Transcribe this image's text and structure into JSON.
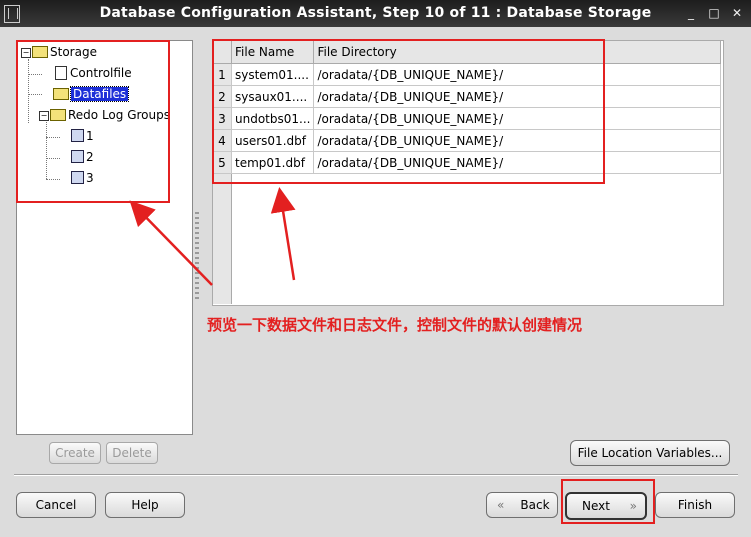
{
  "window": {
    "title": "Database Configuration Assistant, Step 10 of 11 : Database Storage",
    "minimize_glyph": "_",
    "maximize_glyph": "□",
    "close_glyph": "✕"
  },
  "tree": {
    "root": "Storage",
    "controlfile": "Controlfile",
    "datafiles": "Datafiles",
    "redo_groups": "Redo Log Groups",
    "groups": [
      "1",
      "2",
      "3"
    ]
  },
  "table": {
    "headers": [
      "File Name",
      "File Directory"
    ],
    "rows": [
      {
        "num": "1",
        "name": "system01....",
        "dir": "/oradata/{DB_UNIQUE_NAME}/"
      },
      {
        "num": "2",
        "name": "sysaux01....",
        "dir": "/oradata/{DB_UNIQUE_NAME}/"
      },
      {
        "num": "3",
        "name": "undotbs01...",
        "dir": "/oradata/{DB_UNIQUE_NAME}/"
      },
      {
        "num": "4",
        "name": "users01.dbf",
        "dir": "/oradata/{DB_UNIQUE_NAME}/"
      },
      {
        "num": "5",
        "name": "temp01.dbf",
        "dir": "/oradata/{DB_UNIQUE_NAME}/"
      }
    ]
  },
  "annotation": "预览一下数据文件和日志文件，控制文件的默认创建情况",
  "buttons": {
    "create": "Create",
    "delete": "Delete",
    "file_location": "File Location Variables...",
    "cancel": "Cancel",
    "help": "Help",
    "back": "Back",
    "next": "Next",
    "finish": "Finish"
  },
  "colors": {
    "annotation_red": "#e32020",
    "selection_blue": "#1c2fd8"
  }
}
